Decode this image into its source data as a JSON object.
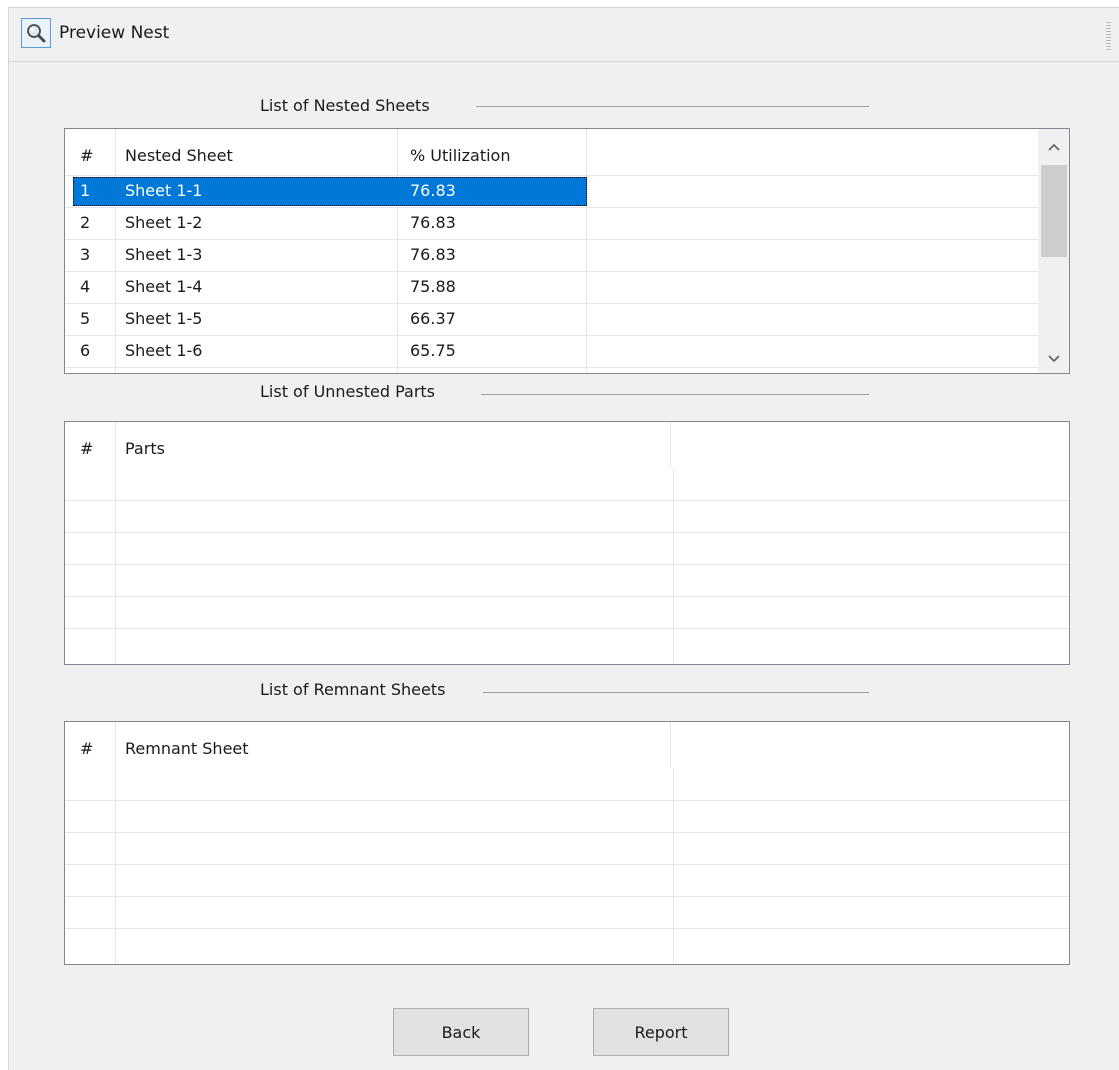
{
  "window": {
    "title": "Preview Nest",
    "title_icon": "magnifier-icon"
  },
  "nested_sheets": {
    "section_label": "List of Nested Sheets",
    "columns": [
      "#",
      "Nested Sheet",
      "% Utilization"
    ],
    "rows": [
      {
        "num": "1",
        "sheet": "Sheet 1-1",
        "util": "76.83",
        "selected": true
      },
      {
        "num": "2",
        "sheet": "Sheet 1-2",
        "util": "76.83",
        "selected": false
      },
      {
        "num": "3",
        "sheet": "Sheet 1-3",
        "util": "76.83",
        "selected": false
      },
      {
        "num": "4",
        "sheet": "Sheet 1-4",
        "util": "75.88",
        "selected": false
      },
      {
        "num": "5",
        "sheet": "Sheet 1-5",
        "util": "66.37",
        "selected": false
      },
      {
        "num": "6",
        "sheet": "Sheet 1-6",
        "util": "65.75",
        "selected": false
      }
    ]
  },
  "unnested_parts": {
    "section_label": "List of Unnested Parts",
    "columns": [
      "#",
      "Parts"
    ]
  },
  "remnant_sheets": {
    "section_label": "List of Remnant Sheets",
    "columns": [
      "#",
      "Remnant Sheet"
    ]
  },
  "buttons": {
    "back": "Back",
    "report": "Report"
  },
  "colors": {
    "selection": "#0078d7",
    "background": "#f0f0f0"
  }
}
